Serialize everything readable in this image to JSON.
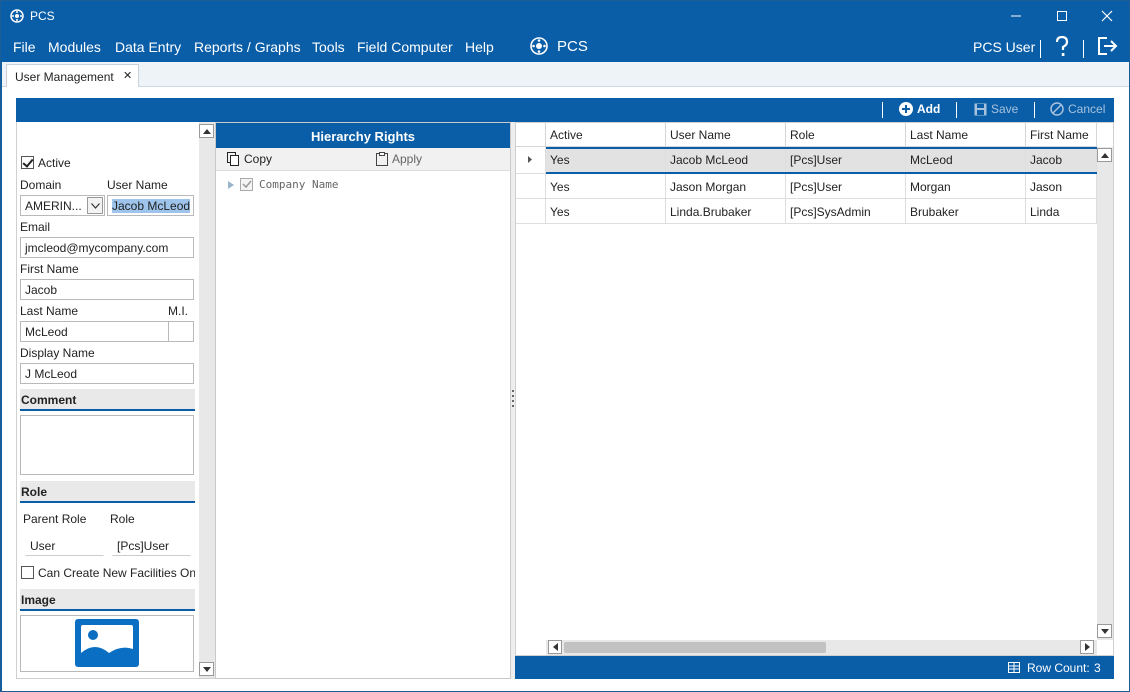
{
  "window": {
    "title": "PCS"
  },
  "menu": {
    "items": [
      "File",
      "Modules",
      "Data Entry",
      "Reports / Graphs",
      "Tools",
      "Field Computer",
      "Help"
    ],
    "brand": "PCS",
    "user": "PCS User"
  },
  "tabs": [
    {
      "label": "User Management",
      "close": "✕"
    }
  ],
  "toolbar": {
    "add": "Add",
    "save": "Save",
    "cancel": "Cancel"
  },
  "form": {
    "active_label": "Active",
    "active_checked": true,
    "domain_label": "Domain",
    "domain_value": "AMERIN...",
    "username_label": "User Name",
    "username_value": "Jacob McLeod",
    "email_label": "Email",
    "email_value": "jmcleod@mycompany.com",
    "firstname_label": "First Name",
    "firstname_value": "Jacob",
    "lastname_label": "Last Name",
    "lastname_value": "McLeod",
    "mi_label": "M.I.",
    "mi_value": "",
    "displayname_label": "Display Name",
    "displayname_value": "J McLeod",
    "comment_header": "Comment",
    "comment_value": "",
    "role_header": "Role",
    "parent_role_label": "Parent Role",
    "parent_role_value": "User",
    "role_label": "Role",
    "role_value": "[Pcs]User",
    "can_create_label": "Can Create New Facilities On",
    "image_header": "Image"
  },
  "hierarchy": {
    "header": "Hierarchy Rights",
    "copy": "Copy",
    "apply": "Apply",
    "tree": [
      {
        "label": "Company Name",
        "checked": true
      }
    ]
  },
  "grid": {
    "columns": [
      "Active",
      "User Name",
      "Role",
      "Last Name",
      "First Name"
    ],
    "rows": [
      [
        "Yes",
        "Jacob McLeod",
        "[Pcs]User",
        "McLeod",
        "Jacob"
      ],
      [
        "Yes",
        "Jason Morgan",
        "[Pcs]User",
        "Morgan",
        "Jason"
      ],
      [
        "Yes",
        "Linda.Brubaker",
        "[Pcs]SysAdmin",
        "Brubaker",
        "Linda"
      ]
    ],
    "selected_row": 0
  },
  "status": {
    "row_count_label": "Row Count:",
    "row_count": "3"
  },
  "colors": {
    "accent": "#0a5ea8",
    "selected_row": "#e2e2e2"
  }
}
